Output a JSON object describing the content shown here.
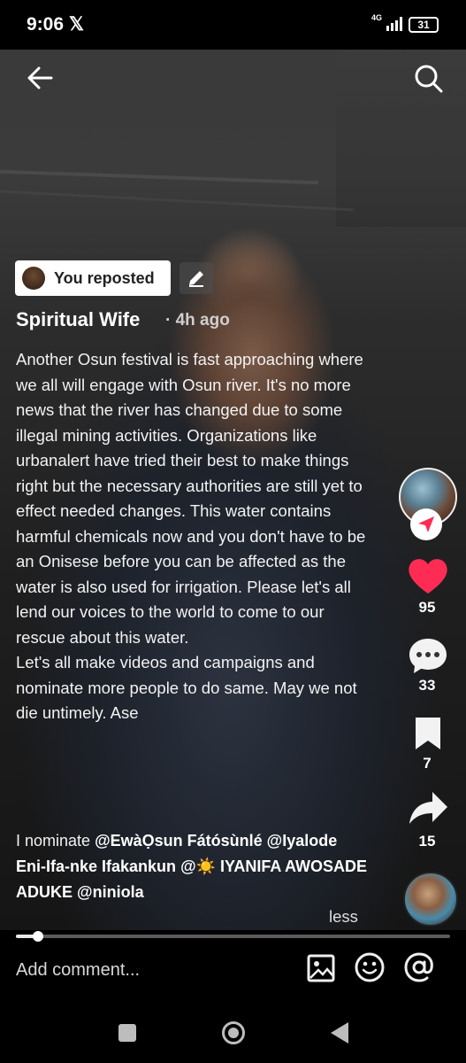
{
  "status_bar": {
    "time": "9:06",
    "x_icon": "𝕏",
    "network": "4G",
    "battery": "31"
  },
  "post": {
    "repost_label": "You reposted",
    "author": "Spiritual Wife",
    "time": "· 4h ago",
    "caption": "Another Osun festival is fast approaching where we all will engage with Osun river. It's no more news that the river has changed due to some illegal mining activities. Organizations like urbanalert have tried their best to make things right but the necessary authorities are still yet to effect needed changes. This water contains harmful chemicals now and you don't have to be an Onisese before you can be affected as the water is also used for irrigation. Please let's all lend our voices to the world to come to our rescue about this water.\nLet's all make videos and campaigns and nominate more people to do same. May we not die untimely. Ase",
    "nominate_prefix": "I nominate ",
    "mentions": [
      "@EwàỌsun Fátósùnlé",
      "@Iyalode Eni-Ifa-nke Ifakankun",
      "@☀️ IYANIFA AWOSADE ADUKE",
      "@niniola"
    ],
    "less_label": "less"
  },
  "actions": {
    "likes": "95",
    "comments": "33",
    "bookmarks": "7",
    "shares": "15",
    "like_color": "#fe2c55"
  },
  "progress": {
    "fraction": 0.05
  },
  "comment_bar": {
    "placeholder": "Add comment..."
  },
  "icons": [
    "back-arrow-icon",
    "search-icon",
    "edit-icon",
    "send-icon",
    "heart-icon",
    "comment-icon",
    "bookmark-icon",
    "share-icon",
    "image-icon",
    "emoji-icon",
    "at-icon"
  ]
}
